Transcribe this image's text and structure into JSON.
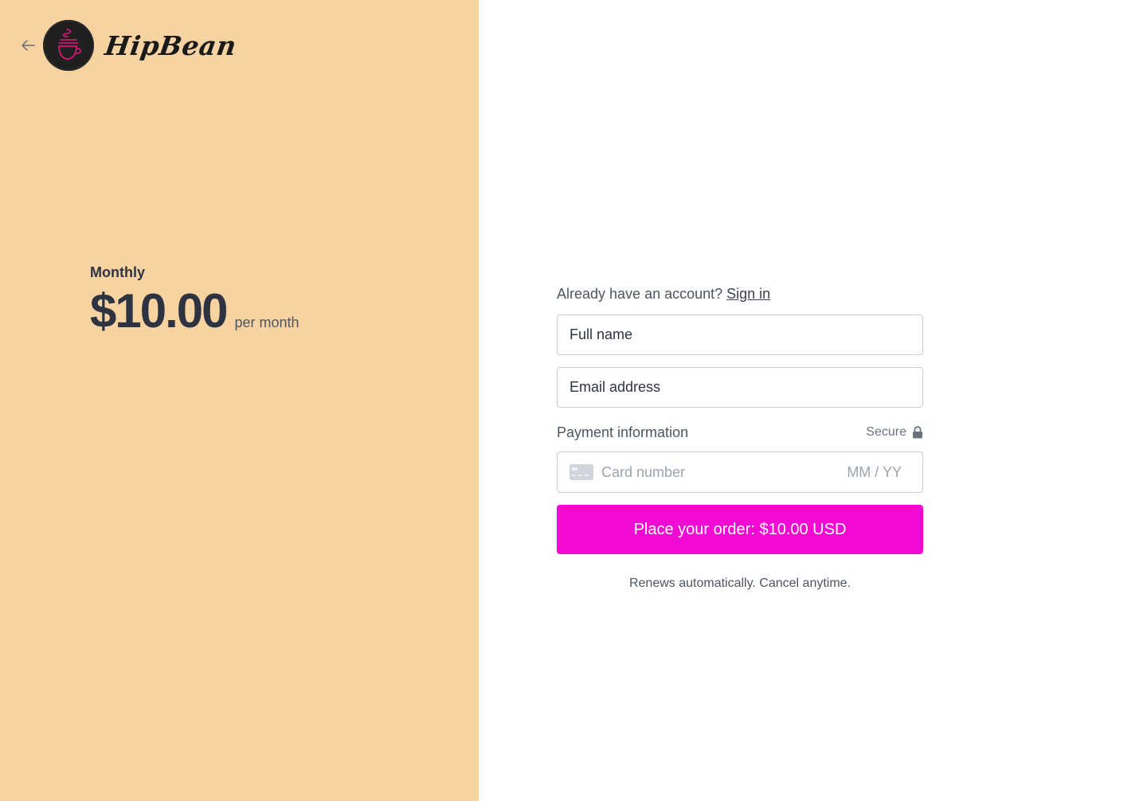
{
  "brand": {
    "name": "HipBean",
    "colors": {
      "left_bg": "#f8d3a2",
      "accent": "#f20ad4",
      "logo_stroke": "#e0137a"
    }
  },
  "nav": {
    "back_icon": "arrow-left-icon"
  },
  "plan": {
    "name": "Monthly",
    "price": "$10.00",
    "period": "per month"
  },
  "form": {
    "signin_prompt": "Already have an account?",
    "signin_link": "Sign in",
    "full_name_placeholder": "Full name",
    "email_placeholder": "Email address",
    "payment_label": "Payment information",
    "secure_label": "Secure",
    "card_number_placeholder": "Card number",
    "expiry_placeholder": "MM / YY",
    "submit_label": "Place your order: $10.00 USD",
    "renew_note": "Renews automatically. Cancel anytime."
  }
}
